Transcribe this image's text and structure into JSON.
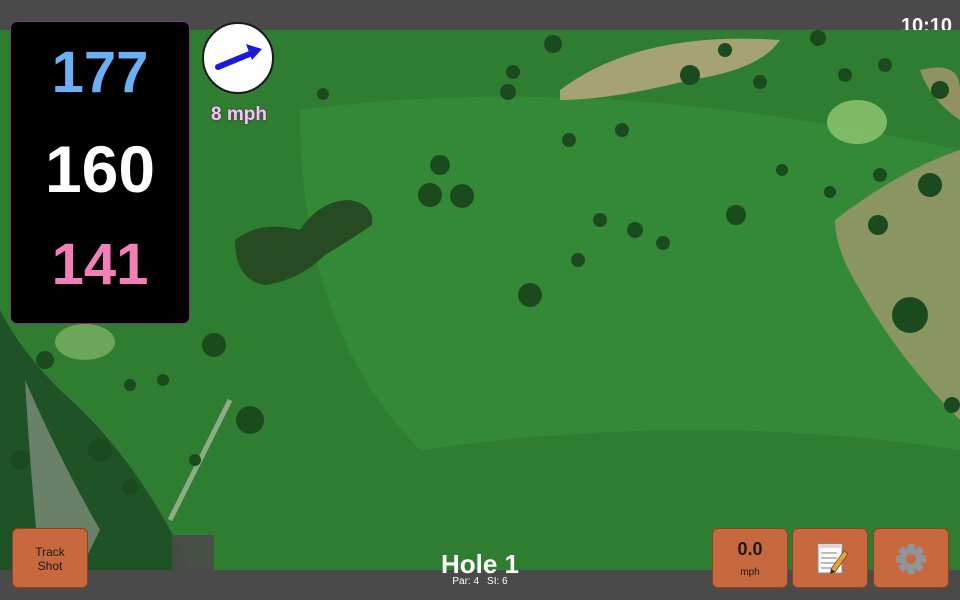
{
  "status_bar": {
    "time": "10:10"
  },
  "distances": {
    "back": "177",
    "center": "160",
    "front": "141",
    "colors": {
      "back": "#6ab0f5",
      "center": "#ffffff",
      "front": "#f27fb8"
    }
  },
  "wind": {
    "icon": "wind-direction-arrow-icon",
    "speed_label": "8 mph",
    "arrow_color": "#1a1adb"
  },
  "map": {
    "view": "satellite"
  },
  "hole": {
    "title": "Hole 1",
    "par": "Par: 4",
    "si": "SI: 6"
  },
  "buttons": {
    "track_shot_line1": "Track",
    "track_shot_line2": "Shot",
    "speed_value": "0.0",
    "speed_unit": "mph",
    "notes_icon": "notepad-icon",
    "settings_icon": "gear-icon",
    "color": "#c8683e"
  }
}
